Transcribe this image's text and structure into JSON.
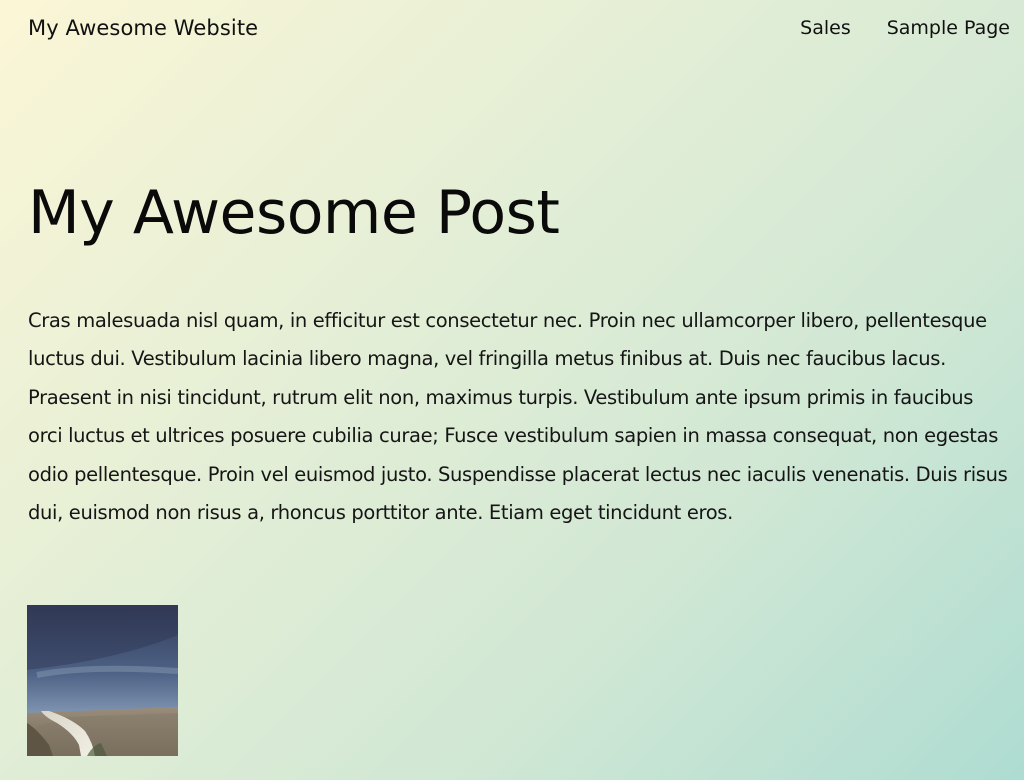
{
  "header": {
    "site_title": "My Awesome Website",
    "nav": [
      {
        "label": "Sales"
      },
      {
        "label": "Sample Page"
      }
    ]
  },
  "post": {
    "title": "My Awesome Post",
    "body": "Cras malesuada nisl quam, in efficitur est consectetur nec. Proin nec ullamcorper libero, pellentesque luctus dui. Vestibulum lacinia libero magna, vel fringilla metus finibus at. Duis nec faucibus lacus. Praesent in nisi tincidunt, rutrum elit non, maximus turpis. Vestibulum ante ipsum primis in faucibus orci luctus et ultrices posuere cubilia curae; Fusce vestibulum sapien in massa consequat, non egestas odio pellentesque. Proin vel euismod justo. Suspendisse placerat lectus nec iaculis venenatis. Duis risus dui, euismod non risus a, rhoncus porttitor ante. Etiam eget tincidunt eros."
  }
}
